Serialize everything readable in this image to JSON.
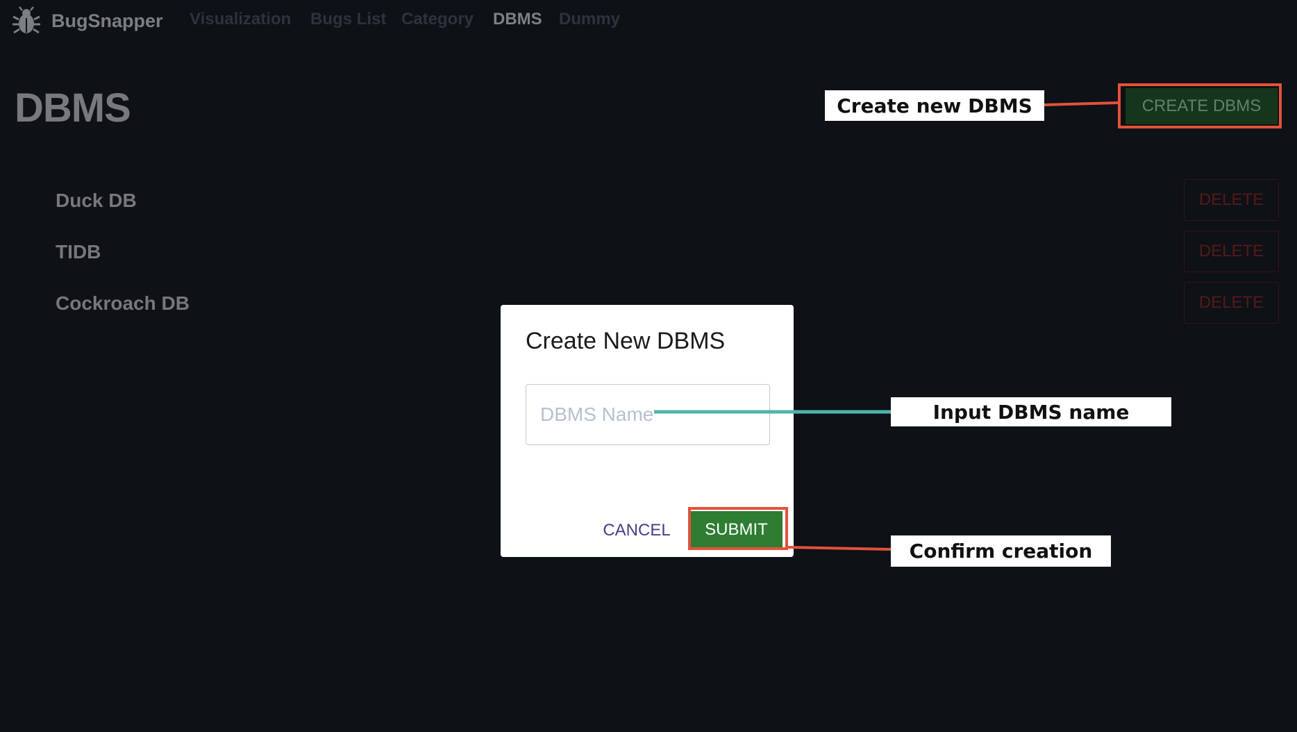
{
  "app": {
    "name": "BugSnapper"
  },
  "nav": {
    "links": [
      "Visualization",
      "Bugs List",
      "Category",
      "DBMS",
      "Dummy"
    ],
    "active": "DBMS"
  },
  "page": {
    "title": "DBMS",
    "create_button": "CREATE DBMS"
  },
  "dbms_list": [
    {
      "name": "Duck DB",
      "action": "DELETE"
    },
    {
      "name": "TIDB",
      "action": "DELETE"
    },
    {
      "name": "Cockroach DB",
      "action": "DELETE"
    }
  ],
  "dialog": {
    "title": "Create New DBMS",
    "input_placeholder": "DBMS Name",
    "input_value": "",
    "cancel_label": "CANCEL",
    "submit_label": "SUBMIT"
  },
  "annotations": {
    "create": "Create new DBMS",
    "input": "Input DBMS name",
    "confirm": "Confirm creation"
  },
  "colors": {
    "background": "#0e1116",
    "highlight": "#e3513a",
    "submit": "#2e7d32",
    "connector_teal": "#4db6ac"
  },
  "icons": {
    "brand": "bug-icon"
  }
}
